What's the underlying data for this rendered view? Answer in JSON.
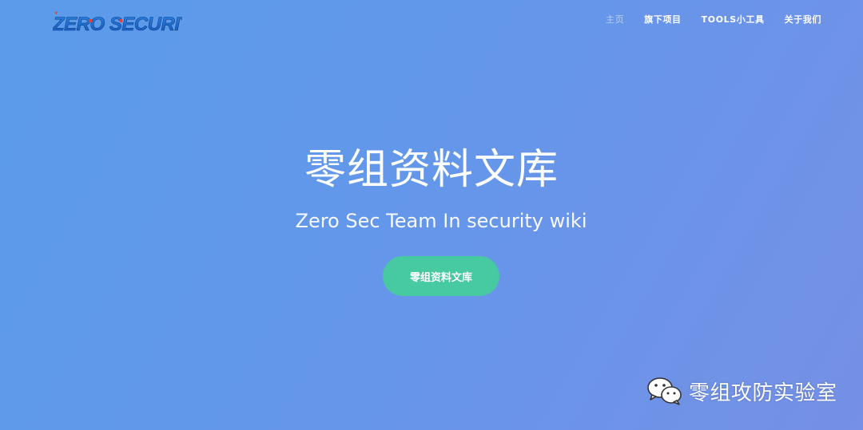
{
  "header": {
    "logo_text": "ZERO SECURITY",
    "nav": [
      {
        "label": "主页",
        "active": true
      },
      {
        "label": "旗下项目",
        "active": false
      },
      {
        "label": "TOOLS小工具",
        "active": false
      },
      {
        "label": "关于我们",
        "active": false
      }
    ]
  },
  "hero": {
    "title": "零组资料文库",
    "subtitle": "Zero Sec Team In security wiki",
    "cta_label": "零组资料文库"
  },
  "watermark": {
    "icon": "wechat-icon",
    "text": "零组攻防实验室"
  },
  "colors": {
    "bg_start": "#5b9bea",
    "bg_end": "#7590e6",
    "cta": "#47c9a2",
    "logo_blue": "#1f6fd1",
    "logo_red": "#e0473a"
  }
}
